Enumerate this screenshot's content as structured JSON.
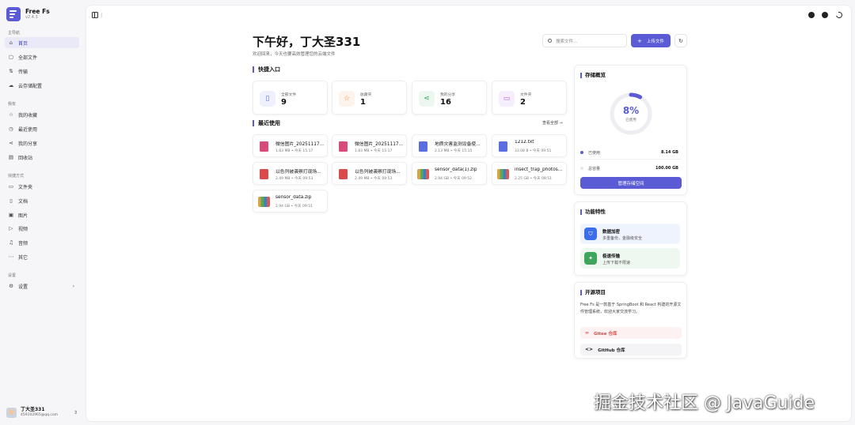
{
  "app": {
    "name": "Free Fs",
    "version": "v2.4.3"
  },
  "sidebar": {
    "sections": [
      {
        "title": "主导航",
        "items": [
          "首页",
          "全部文件",
          "传输",
          "云存储配置"
        ]
      },
      {
        "title": "我有",
        "items": [
          "我的收藏",
          "最近使用",
          "我的分享",
          "回收站"
        ]
      },
      {
        "title": "快捷方式",
        "items": [
          "文件夹",
          "文档",
          "图片",
          "视频",
          "音频",
          "其它"
        ]
      },
      {
        "title": "设置",
        "items": [
          "设置"
        ]
      }
    ],
    "user": {
      "name": "丁大圣331",
      "email": "459102965@qq.com"
    }
  },
  "header": {
    "greeting": "下午好，丁大圣331",
    "subtitle": "欢迎回来，今天也要高效管理您的云端文件",
    "search_placeholder": "搜索文件...",
    "upload_label": "上传文件"
  },
  "quick_access": {
    "title": "快捷入口",
    "cards": [
      {
        "label": "全部文件",
        "value": "9",
        "icon": "file-icon",
        "color": "#5b6ee1"
      },
      {
        "label": "收藏夹",
        "value": "1",
        "icon": "star-icon",
        "color": "#e08a3c"
      },
      {
        "label": "我的分享",
        "value": "16",
        "icon": "share-icon",
        "color": "#3fa55b"
      },
      {
        "label": "文件夹",
        "value": "2",
        "icon": "folder-icon",
        "color": "#b05bd6"
      }
    ]
  },
  "recent": {
    "title": "最近使用",
    "view_all": "查看全部 →",
    "files": [
      {
        "name": "微信图片_20251117...",
        "size": "1.83 MB",
        "time": "今天 15:17",
        "type": "img"
      },
      {
        "name": "微信图片_20251117...",
        "size": "1.83 MB",
        "time": "今天 15:17",
        "type": "img"
      },
      {
        "name": "地质灾害监测设备使...",
        "size": "2.13 MB",
        "time": "今天 15:15",
        "type": "doc"
      },
      {
        "name": "1212.txt",
        "size": "33.08 B",
        "time": "今天 09:51",
        "type": "doc"
      },
      {
        "name": "以色列被袭察打现场...",
        "size": "2.49 MB",
        "time": "今天 09:53",
        "type": "pdf"
      },
      {
        "name": "以色列被袭察打现场...",
        "size": "2.49 MB",
        "time": "今天 09:53",
        "type": "pdf"
      },
      {
        "name": "sensor_data(1).zip",
        "size": "2.94 GB",
        "time": "今天 09:52",
        "type": "zip"
      },
      {
        "name": "insect_trap_photos...",
        "size": "2.25 GB",
        "time": "今天 09:51",
        "type": "zip"
      },
      {
        "name": "sensor_data.zip",
        "size": "2.94 GB",
        "time": "今天 09:51",
        "type": "zip"
      }
    ]
  },
  "storage": {
    "title": "存储概览",
    "percent_label": "8%",
    "percent_value": 0.08,
    "percent_sub": "已使用",
    "used_label": "已使用",
    "used_value": "8.14 GB",
    "total_label": "总容量",
    "total_value": "100.00 GB",
    "manage_label": "管理存储空间",
    "accent": "#5b5bd6"
  },
  "features": {
    "title": "功能特性",
    "items": [
      {
        "title": "数据加密",
        "desc": "多重备份，金融级安全",
        "icon": "shield-icon",
        "color": "#3b6ee8",
        "bg": "#eef3fe"
      },
      {
        "title": "极速传输",
        "desc": "上传下载不限速",
        "icon": "bolt-icon",
        "color": "#3fa55b",
        "bg": "#eef8f0"
      }
    ]
  },
  "opensource": {
    "title": "开源项目",
    "desc": "Free Fs 是一款基于 SpringBoot 和 React 构建的开源文件管理系统，欢迎大家交流学习。",
    "gitee_label": "Gitee 仓库",
    "github_label": "GitHub 仓库"
  },
  "watermark": "掘金技术社区 @ JavaGuide"
}
